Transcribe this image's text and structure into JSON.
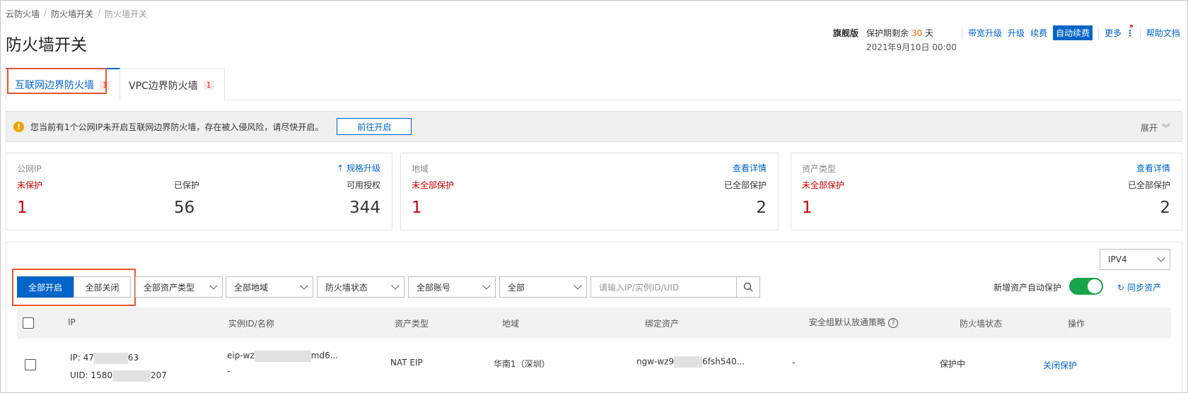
{
  "breadcrumb": [
    "云防火墙",
    "防火墙开关",
    "防火墙开关"
  ],
  "page_title": "防火墙开关",
  "header": {
    "edition": "旗舰版",
    "protect_prefix": "保护期剩余",
    "days": "30",
    "days_unit": "天",
    "expire_date": "2021年9月10日 00:00",
    "links": {
      "bandwidth": "带宽升级",
      "upgrade": "升级",
      "renew": "续费",
      "auto_renew": "自动续费",
      "more": "更多",
      "help": "帮助文档"
    }
  },
  "tabs": [
    {
      "label": "互联网边界防火墙",
      "badge": "1"
    },
    {
      "label": "VPC边界防火墙",
      "badge": "1"
    }
  ],
  "notice": {
    "text": "您当前有1个公网IP未开启互联网边界防火墙，存在被入侵风险，请尽快开启。",
    "button": "前往开启",
    "expand": "展开"
  },
  "cards": {
    "ip": {
      "title": "公网IP",
      "link": "规格升级",
      "col1_label": "未保护",
      "col1_value": "1",
      "col2_label": "已保护",
      "col2_value": "56",
      "col3_label": "可用授权",
      "col3_value": "344"
    },
    "region": {
      "title": "地域",
      "link": "查看详情",
      "col1_label": "未全部保护",
      "col1_value": "1",
      "col2_label": "已全部保护",
      "col2_value": "2"
    },
    "asset": {
      "title": "资产类型",
      "link": "查看详情",
      "col1_label": "未全部保护",
      "col1_value": "1",
      "col2_label": "已全部保护",
      "col2_value": "2"
    }
  },
  "toolbar": {
    "ip_version": "IPV4",
    "enable_all": "全部开启",
    "disable_all": "全部关闭",
    "filters": [
      "全部资产类型",
      "全部地域",
      "防火墙状态",
      "全部账号",
      "全部"
    ],
    "search_placeholder": "请输入IP/实例ID/UID",
    "auto_protect_label": "新增资产自动保护",
    "auto_protect_on": true,
    "sync": "同步资产"
  },
  "table": {
    "columns": [
      "IP",
      "实例ID/名称",
      "资产类型",
      "地域",
      "绑定资产",
      "安全组默认放通策略",
      "防火墙状态",
      "操作"
    ],
    "rows": [
      {
        "ip_prefix": "IP: 47",
        "ip_suffix": "63",
        "uid_prefix": "UID: 1580",
        "uid_suffix": "207",
        "instance_prefix": "eip-wz",
        "instance_suffix": "md6...",
        "instance_name": "-",
        "asset_type": "NAT EIP",
        "region": "华南1（深圳）",
        "bound_prefix": "ngw-wz9",
        "bound_suffix": "6fsh540...",
        "sg_policy": "-",
        "status": "保护中",
        "action": "关闭保护"
      }
    ]
  }
}
